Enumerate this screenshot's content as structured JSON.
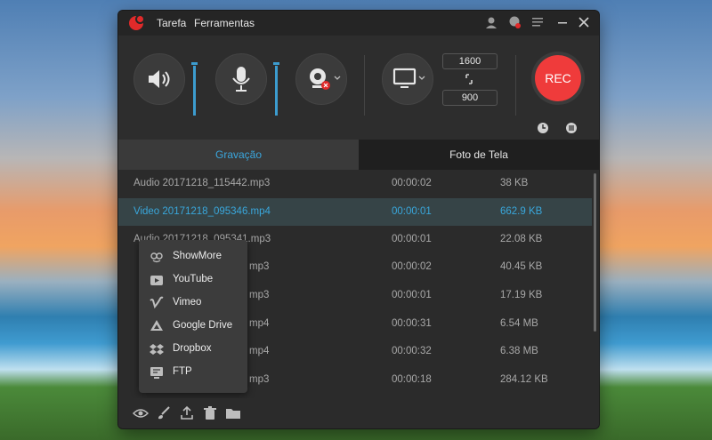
{
  "titlebar": {
    "menu": [
      "Tarefa",
      "Ferramentas"
    ],
    "icons": [
      "user-icon",
      "notification-icon",
      "menu-icon",
      "minimize-icon",
      "close-icon"
    ]
  },
  "toolbar": {
    "resolution": {
      "width": "1600",
      "height": "900"
    },
    "rec_label": "REC",
    "icons": [
      "speaker-icon",
      "microphone-icon",
      "webcam-icon",
      "screen-icon",
      "link-icon",
      "clock-icon",
      "settings-icon"
    ]
  },
  "tabs": {
    "recording": "Gravação",
    "screenshot": "Foto de Tela"
  },
  "files": [
    {
      "name": "Audio 20171218_115442.mp3",
      "duration": "00:00:02",
      "size": "38 KB"
    },
    {
      "name": "Video 20171218_095346.mp4",
      "duration": "00:00:01",
      "size": "662.9 KB",
      "selected": true
    },
    {
      "name": "Audio 20171218_095341.mp3",
      "duration": "00:00:01",
      "size": "22.08 KB"
    },
    {
      "name": "mp3",
      "duration": "00:00:02",
      "size": "40.45 KB"
    },
    {
      "name": "mp3",
      "duration": "00:00:01",
      "size": "17.19 KB"
    },
    {
      "name": "mp4",
      "duration": "00:00:31",
      "size": "6.54 MB"
    },
    {
      "name": "mp4",
      "duration": "00:00:32",
      "size": "6.38 MB"
    },
    {
      "name": "mp3",
      "duration": "00:00:18",
      "size": "284.12 KB"
    }
  ],
  "share_menu": [
    {
      "label": "ShowMore",
      "icon": "showmore-icon"
    },
    {
      "label": "YouTube",
      "icon": "youtube-icon"
    },
    {
      "label": "Vimeo",
      "icon": "vimeo-icon"
    },
    {
      "label": "Google Drive",
      "icon": "google-drive-icon"
    },
    {
      "label": "Dropbox",
      "icon": "dropbox-icon"
    },
    {
      "label": "FTP",
      "icon": "ftp-icon"
    }
  ],
  "bottom_icons": [
    "eye-icon",
    "brush-icon",
    "upload-icon",
    "trash-icon",
    "folder-icon"
  ],
  "colors": {
    "accent": "#3aa6dd",
    "rec": "#ef3b3b"
  }
}
